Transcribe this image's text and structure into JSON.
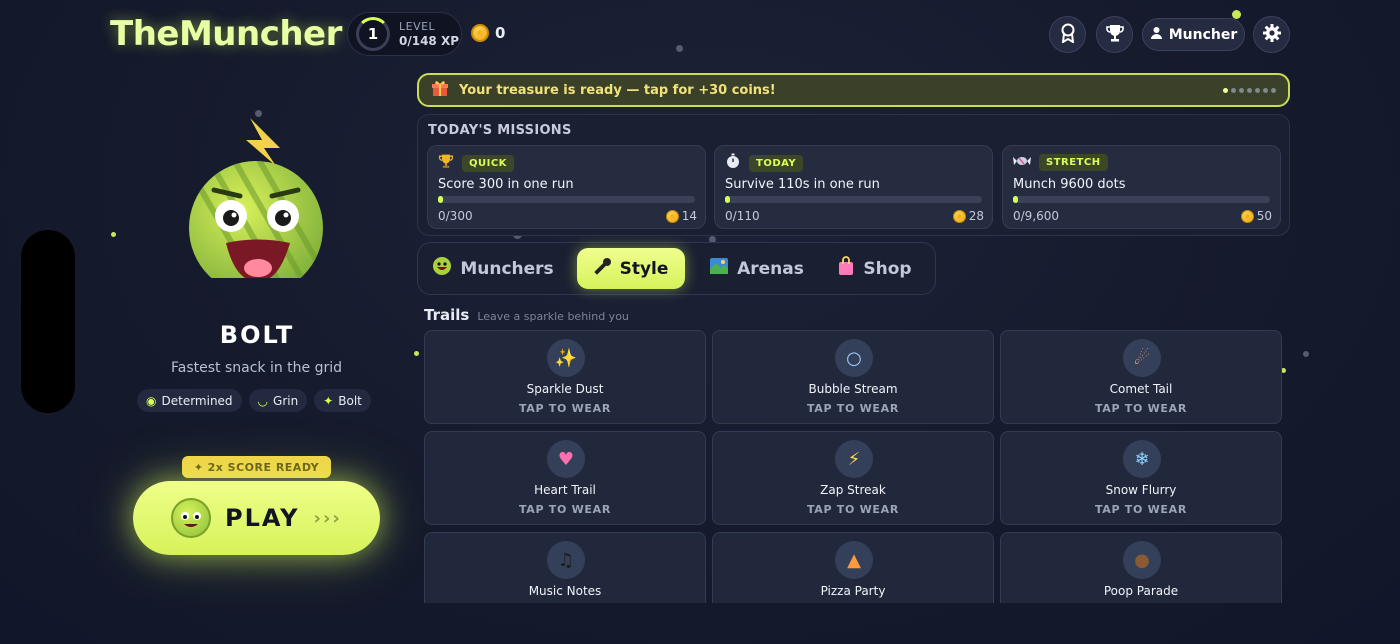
{
  "app": {
    "title": "TheMuncher"
  },
  "header": {
    "level": {
      "number": "1",
      "label": "LEVEL",
      "xp": "0/148 XP"
    },
    "coins": "0",
    "username": "Muncher",
    "icons": {
      "achievements": "ribbon-icon",
      "leaderboard": "trophy-icon",
      "profile": "person-icon",
      "settings": "gear-icon"
    }
  },
  "character": {
    "name": "BOLT",
    "tagline": "Fastest snack in the grid",
    "traits": [
      {
        "icon": "eye-icon",
        "label": "Determined"
      },
      {
        "icon": "lips-icon",
        "label": "Grin"
      },
      {
        "icon": "sparkle-icon",
        "label": "Bolt"
      }
    ]
  },
  "play": {
    "badge": "2x SCORE READY",
    "label": "PLAY",
    "arrows": "›››"
  },
  "treasure": {
    "text": "Your treasure is ready — tap for +30 coins!",
    "pages": 7,
    "active_page": 0
  },
  "missions": {
    "title": "TODAY'S MISSIONS",
    "items": [
      {
        "icon": "trophy-icon",
        "badge": "QUICK",
        "title": "Score 300 in one run",
        "progress_text": "0/300",
        "progress": 0.0,
        "reward": "14"
      },
      {
        "icon": "stopwatch-icon",
        "badge": "TODAY",
        "title": "Survive 110s in one run",
        "progress_text": "0/110",
        "progress": 0.0,
        "reward": "28"
      },
      {
        "icon": "candy-icon",
        "badge": "STRETCH",
        "title": "Munch 9600 dots",
        "progress_text": "0/9,600",
        "progress": 0.0,
        "reward": "50"
      }
    ]
  },
  "tabs": [
    {
      "label": "Munchers",
      "icon": "muncher-face-icon",
      "active": false
    },
    {
      "label": "Style",
      "icon": "microphone-icon",
      "active": true
    },
    {
      "label": "Arenas",
      "icon": "map-icon",
      "active": false
    },
    {
      "label": "Shop",
      "icon": "shopping-bag-icon",
      "active": false
    }
  ],
  "trails": {
    "title": "Trails",
    "subtitle": "Leave a sparkle behind you",
    "items": [
      {
        "name": "Sparkle Dust",
        "glyph": "✨",
        "action": "TAP TO WEAR"
      },
      {
        "name": "Bubble Stream",
        "glyph": "○",
        "action": "TAP TO WEAR"
      },
      {
        "name": "Comet Tail",
        "glyph": "☄",
        "action": "TAP TO WEAR"
      },
      {
        "name": "Heart Trail",
        "glyph": "♥",
        "action": "TAP TO WEAR"
      },
      {
        "name": "Zap Streak",
        "glyph": "⚡",
        "action": "TAP TO WEAR"
      },
      {
        "name": "Snow Flurry",
        "glyph": "❄",
        "action": "TAP TO WEAR"
      },
      {
        "name": "Music Notes",
        "glyph": "♫",
        "action": ""
      },
      {
        "name": "Pizza Party",
        "glyph": "▲",
        "action": ""
      },
      {
        "name": "Poop Parade",
        "glyph": "●",
        "action": ""
      }
    ]
  },
  "colors": {
    "accent": "#d8ff55",
    "brand": "#e9ffa3",
    "background": "#151a2c"
  }
}
